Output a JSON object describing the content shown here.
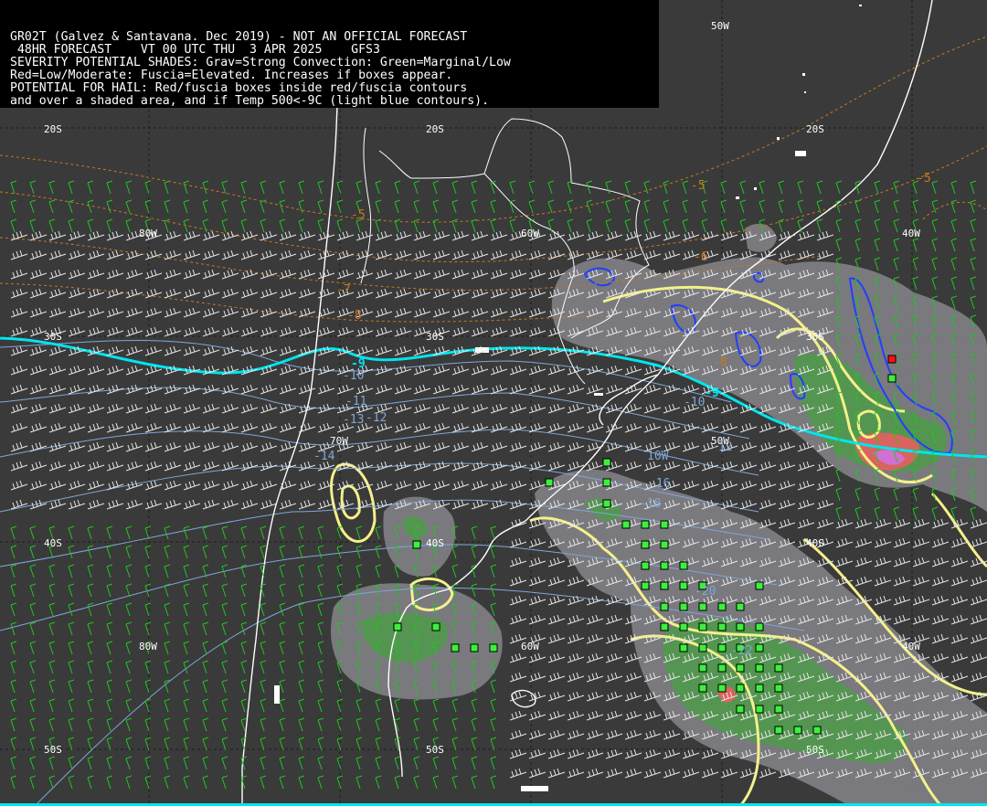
{
  "header": {
    "line1": "GR02T (Galvez & Santavana. Dec 2019) - NOT AN OFFICIAL FORECAST",
    "line2": " 48HR FORECAST    VT 00 UTC THU  3 APR 2025    GFS3",
    "line3": "SEVERITY POTENTIAL SHADES: Grav=Strong Convection: Green=Marginal/Low",
    "line4": "Red=Low/Moderate: Fuscia=Elevated. Increases if boxes appear.",
    "line5": "POTENTIAL FOR HAIL: Red/fuscia boxes inside red/fuscia contours",
    "line6": "and over a shaded area, and if Temp 500<-9C (light blue contours)."
  },
  "grid_labels": {
    "lon_50w_top": "50W",
    "lat_20s_a": "20S",
    "lat_20s_b": "20S",
    "lat_20s_c": "20S",
    "lon_80w_a": "80W",
    "lon_60w_a": "60W",
    "lon_40w_a": "40W",
    "lat_30s_a": "30S",
    "lat_30s_b": "30S",
    "lat_30s_c": "30S",
    "lon_70w": "70W",
    "lon_50w_mid": "50W",
    "lat_40s_a": "40S",
    "lat_40s_b": "40S",
    "lat_40s_c": "40S",
    "lon_80w_b": "80W",
    "lon_60w_b": "60W",
    "lon_40w_b": "40W",
    "lat_50s_a": "50S",
    "lat_50s_b": "50S",
    "lat_50s_c": "50S"
  },
  "temp_labels": {
    "t5a": "-5",
    "t5b": "-5",
    "t5c": "-5",
    "t6": "-6",
    "t7": "-7",
    "t8": "-8",
    "t8b": "-8",
    "t9a": "-9",
    "t9b": "-9",
    "t10a": "-10",
    "t10b": "-10",
    "t11": "-11",
    "t12": "-12",
    "t13": "-13",
    "t14": "-14",
    "t16": "-16",
    "t18": "-18",
    "t20": "-20",
    "t22": "-22",
    "t12b": "-12",
    "t10c": "10W"
  },
  "colors": {
    "background": "#3a3a3a",
    "coast": "#ffffff",
    "wind_green": "#1ec81e",
    "wind_white": "#e6e6e6",
    "temp_500_neg9": "#00e5ee",
    "temp_contour": "#7fa7d8",
    "thickness_dashed": "#c8781e",
    "shade_gray": "#8a8a90",
    "shade_green": "#4f9a4a",
    "shade_red": "#d9645f",
    "shade_fuscia": "#d070d0",
    "yellow_contour": "#f5f08a",
    "blue_contour": "#2040ff",
    "green_box": "#3cf03c",
    "red_box": "#ff1010"
  }
}
